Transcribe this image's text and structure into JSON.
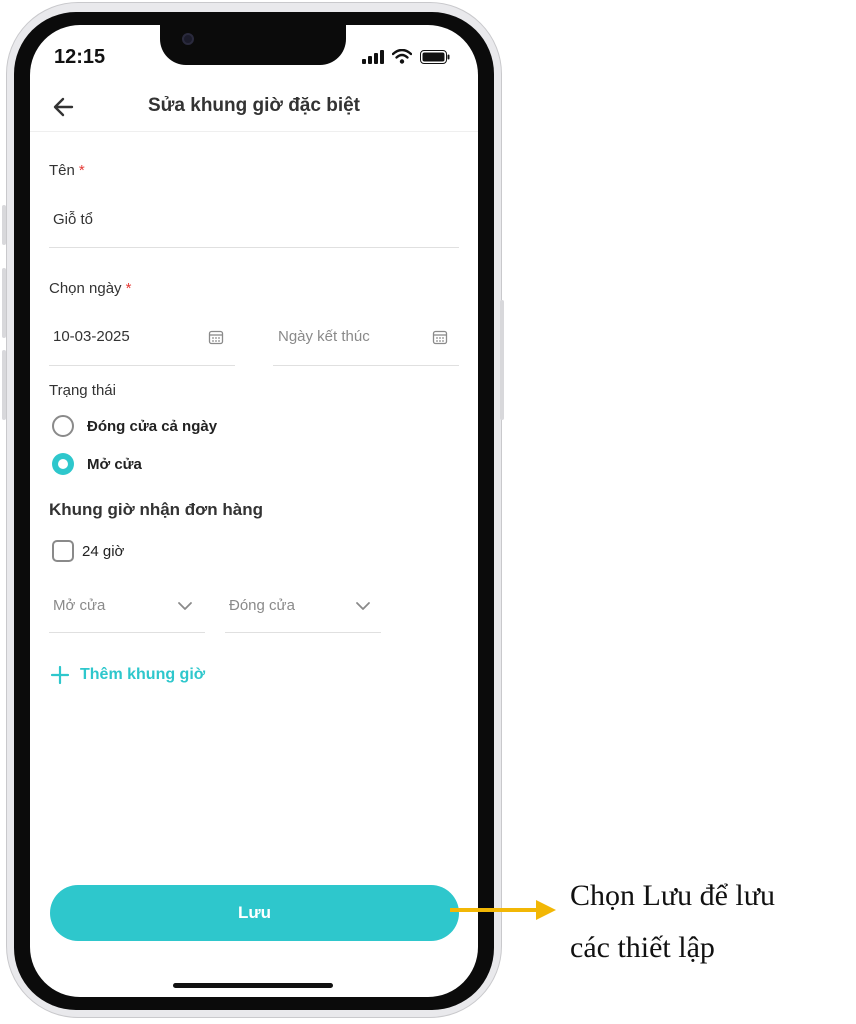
{
  "status_bar": {
    "time": "12:15"
  },
  "header": {
    "title": "Sửa khung giờ đặc biệt",
    "back_icon": "arrow-left-icon"
  },
  "form": {
    "name": {
      "label": "Tên",
      "required_mark": "*",
      "value": "Giỗ tổ"
    },
    "date": {
      "label": "Chọn ngày",
      "required_mark": "*",
      "start_value": "10-03-2025",
      "end_placeholder": "Ngày kết thúc",
      "icon": "calendar-icon"
    },
    "status": {
      "label": "Trạng thái",
      "options": [
        {
          "label": "Đóng cửa cả ngày",
          "selected": false
        },
        {
          "label": "Mở cửa",
          "selected": true
        }
      ]
    },
    "hours": {
      "title": "Khung giờ nhận đơn hàng",
      "all_day_label": "24 giờ",
      "all_day_checked": false,
      "open_placeholder": "Mở cửa",
      "close_placeholder": "Đóng cửa",
      "add_label": "Thêm khung giờ"
    }
  },
  "save_button": {
    "label": "Lưu"
  },
  "annotation": {
    "line1": "Chọn Lưu để lưu",
    "line2": "các thiết lập"
  },
  "colors": {
    "accent": "#2ec7cc",
    "required": "#e53935",
    "arrow": "#f2b705"
  }
}
